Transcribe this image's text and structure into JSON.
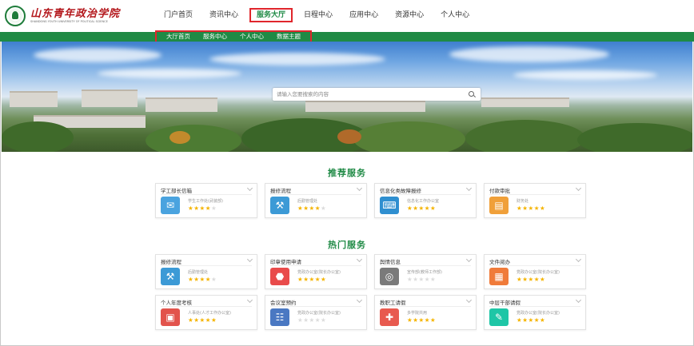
{
  "school": {
    "name_cn": "山东青年政治学院",
    "name_en": "SHANDONG YOUTH UNIVERSITY OF POLITICAL SCIENCE"
  },
  "nav": [
    {
      "label": "门户首页",
      "active": false
    },
    {
      "label": "资讯中心",
      "active": false
    },
    {
      "label": "服务大厅",
      "active": true
    },
    {
      "label": "日程中心",
      "active": false
    },
    {
      "label": "应用中心",
      "active": false
    },
    {
      "label": "资源中心",
      "active": false
    },
    {
      "label": "个人中心",
      "active": false
    }
  ],
  "subnav": [
    {
      "label": "大厅首页"
    },
    {
      "label": "服务中心"
    },
    {
      "label": "个人中心"
    },
    {
      "label": "数据主题"
    }
  ],
  "search": {
    "placeholder": "请输入您要搜索的内容"
  },
  "recommended": {
    "title": "推荐服务",
    "cards": [
      {
        "title": "学工部长信箱",
        "sub": "学生工作处(武装部)",
        "rating": 4,
        "icon": "mailbox-icon",
        "color": "#4aa3df"
      },
      {
        "title": "报修流程",
        "sub": "后勤管理处",
        "rating": 4,
        "icon": "repair-tools-icon",
        "color": "#3c9ad6"
      },
      {
        "title": "信息化类故障报修",
        "sub": "信息化工作办公室",
        "rating": 5,
        "icon": "computer-repair-icon",
        "color": "#2f8fd0"
      },
      {
        "title": "付款审批",
        "sub": "财务处",
        "rating": 5,
        "icon": "payment-document-icon",
        "color": "#f0a03a"
      }
    ]
  },
  "hot": {
    "title": "热门服务",
    "cards": [
      {
        "title": "报修流程",
        "sub": "后勤管理处",
        "rating": 4,
        "icon": "repair-tools-icon",
        "color": "#3c9ad6"
      },
      {
        "title": "印章使用申请",
        "sub": "党政办公室(院长办公室)",
        "rating": 5,
        "icon": "seal-stamp-icon",
        "color": "#e94b4b"
      },
      {
        "title": "舆情信息",
        "sub": "宣传部(教师工作部)",
        "rating": 0,
        "icon": "public-opinion-icon",
        "color": "#7a7a7a"
      },
      {
        "title": "文件阅办",
        "sub": "党政办公室(院长办公室)",
        "rating": 5,
        "icon": "file-reading-icon",
        "color": "#f07b3a"
      },
      {
        "title": "个人年度考核",
        "sub": "人事处(人才工作办公室)",
        "rating": 5,
        "icon": "calendar-assessment-icon",
        "color": "#e2534c"
      },
      {
        "title": "会议室预约",
        "sub": "党政办公室(院长办公室)",
        "rating": 0,
        "icon": "meeting-room-icon",
        "color": "#4a78c2"
      },
      {
        "title": "教职工请假",
        "sub": "多学院共用",
        "rating": 5,
        "icon": "staff-leave-icon",
        "color": "#e85a4f"
      },
      {
        "title": "中层干部请假",
        "sub": "党政办公室(院长办公室)",
        "rating": 5,
        "icon": "cadre-leave-icon",
        "color": "#1ec6a6"
      }
    ]
  }
}
